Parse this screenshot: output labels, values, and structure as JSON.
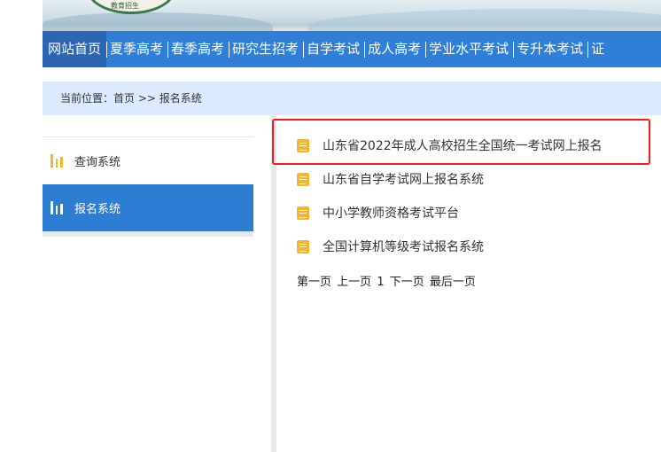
{
  "banner": {
    "seal_text": "教育招生"
  },
  "nav": {
    "items": [
      "网站首页",
      "夏季高考",
      "春季高考",
      "研究生招考",
      "自学考试",
      "成人高考",
      "学业水平考试",
      "专升本考试",
      "证"
    ],
    "active": 0
  },
  "breadcrumb": {
    "text": "当前位置：首页 >> 报名系统"
  },
  "sidebar": {
    "items": [
      {
        "label": "查询系统",
        "icon": "bar-chart-icon"
      },
      {
        "label": "报名系统",
        "icon": "bar-chart-icon",
        "active": true
      }
    ]
  },
  "list": {
    "items": [
      "山东省2022年成人高校招生全国统一考试网上报名",
      "山东省自学考试网上报名系统",
      "中小学教师资格考试平台",
      "全国计算机等级考试报名系统"
    ],
    "highlighted": 0
  },
  "pager": {
    "first": "第一页",
    "prev": "上一页",
    "current": "1",
    "next": "下一页",
    "last": "最后一页"
  },
  "colors": {
    "nav": "#2f7fd9",
    "active_nav": "#2a66b1",
    "breadcrumb_bg": "#dbeafc",
    "icon": "#f7b52c",
    "highlight": "#f21c1c"
  }
}
